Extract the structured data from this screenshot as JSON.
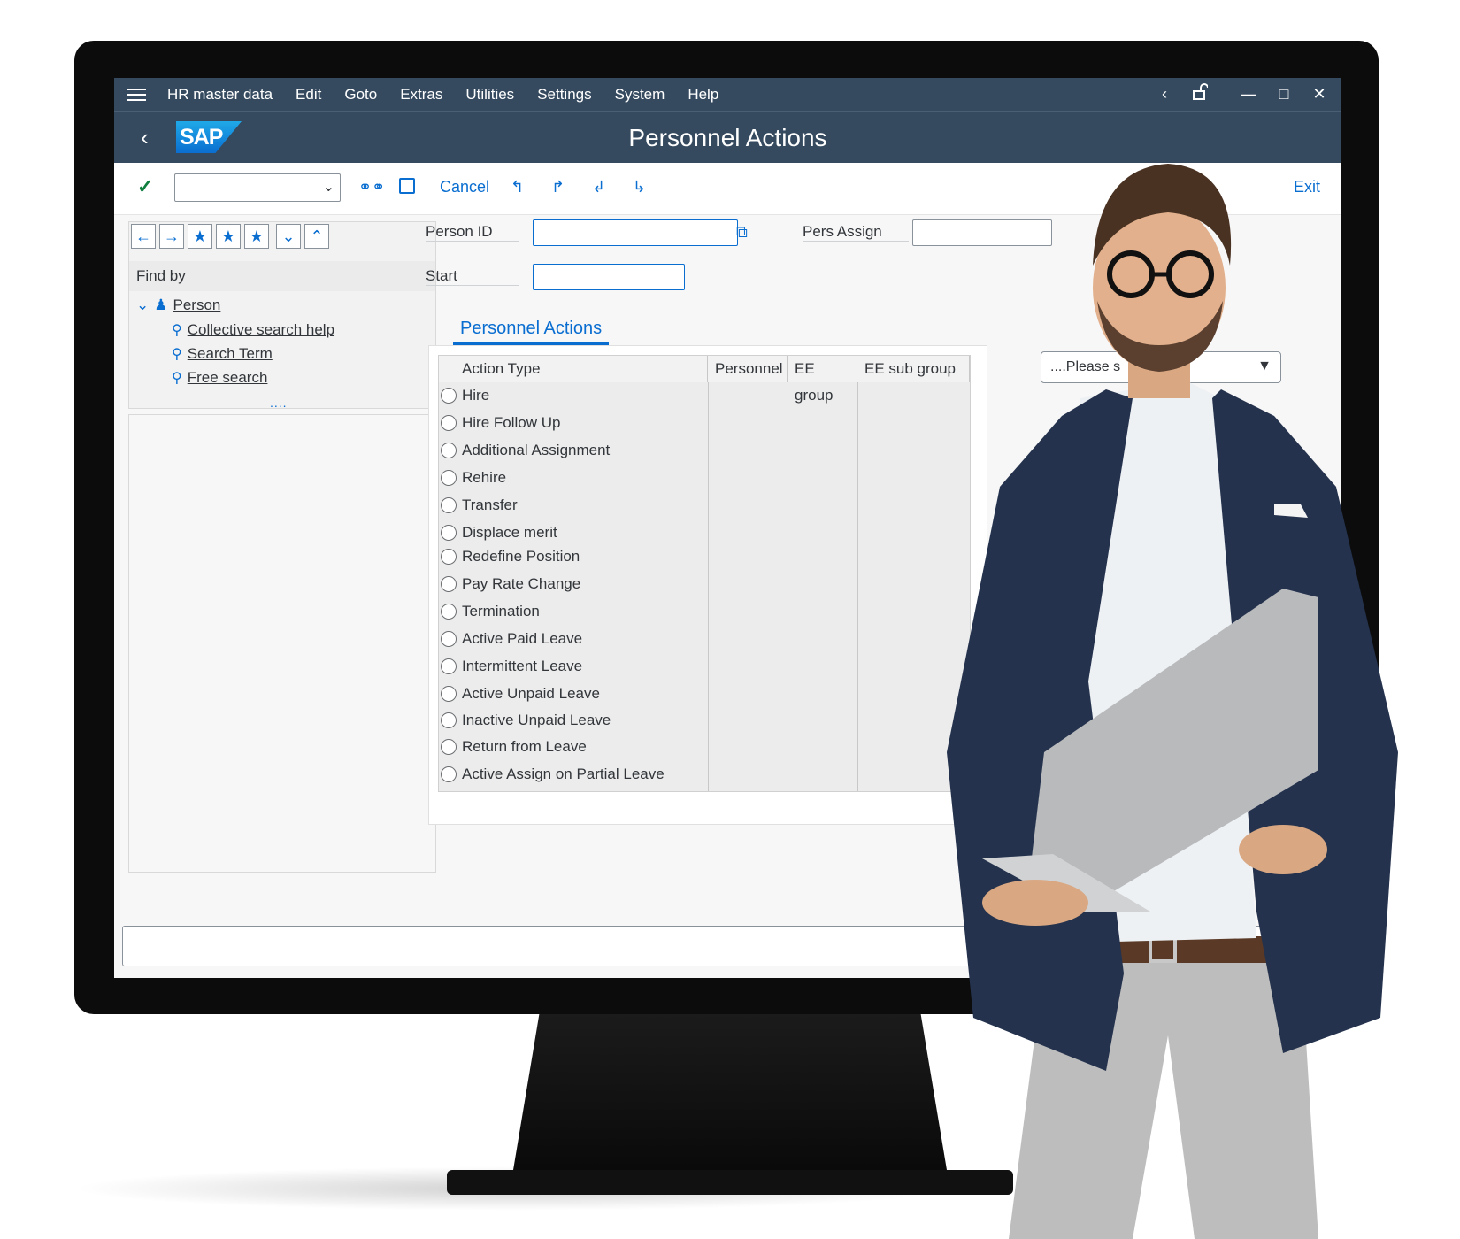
{
  "menubar": {
    "items": [
      "HR master data",
      "Edit",
      "Goto",
      "Extras",
      "Utilities",
      "Settings",
      "System",
      "Help"
    ]
  },
  "titlebar": {
    "logo": "SAP",
    "title": "Personnel Actions"
  },
  "toolbar": {
    "cancel": "Cancel",
    "exit": "Exit"
  },
  "left": {
    "find_by": "Find by",
    "tree": {
      "root": "Person",
      "children": [
        "Collective search help",
        "Search Term",
        "Free search"
      ]
    },
    "dots": "...."
  },
  "form": {
    "person_id_label": "Person ID",
    "person_id_value": "",
    "start_label": "Start",
    "start_value": "",
    "pers_assign_label": "Pers Assign",
    "pers_assign_value": "",
    "tab": "Personnel Actions",
    "select_placeholder": "....Please s"
  },
  "table": {
    "columns": [
      "Action Type",
      "Personnel",
      "EE group",
      "EE sub group"
    ],
    "rows": [
      "Hire",
      "Hire Follow Up",
      "Additional Assignment",
      "Rehire",
      "Transfer",
      "Displace merit",
      "Redefine Position",
      "Pay Rate Change",
      "Termination",
      "Active Paid Leave",
      "Intermittent Leave",
      "Active Unpaid Leave",
      "Inactive Unpaid Leave",
      "Return from Leave",
      "Active Assign on Partial Leave"
    ]
  },
  "colors": {
    "shell": "#354a5f",
    "accent": "#0a6ed1",
    "confirm": "#107e3e"
  }
}
